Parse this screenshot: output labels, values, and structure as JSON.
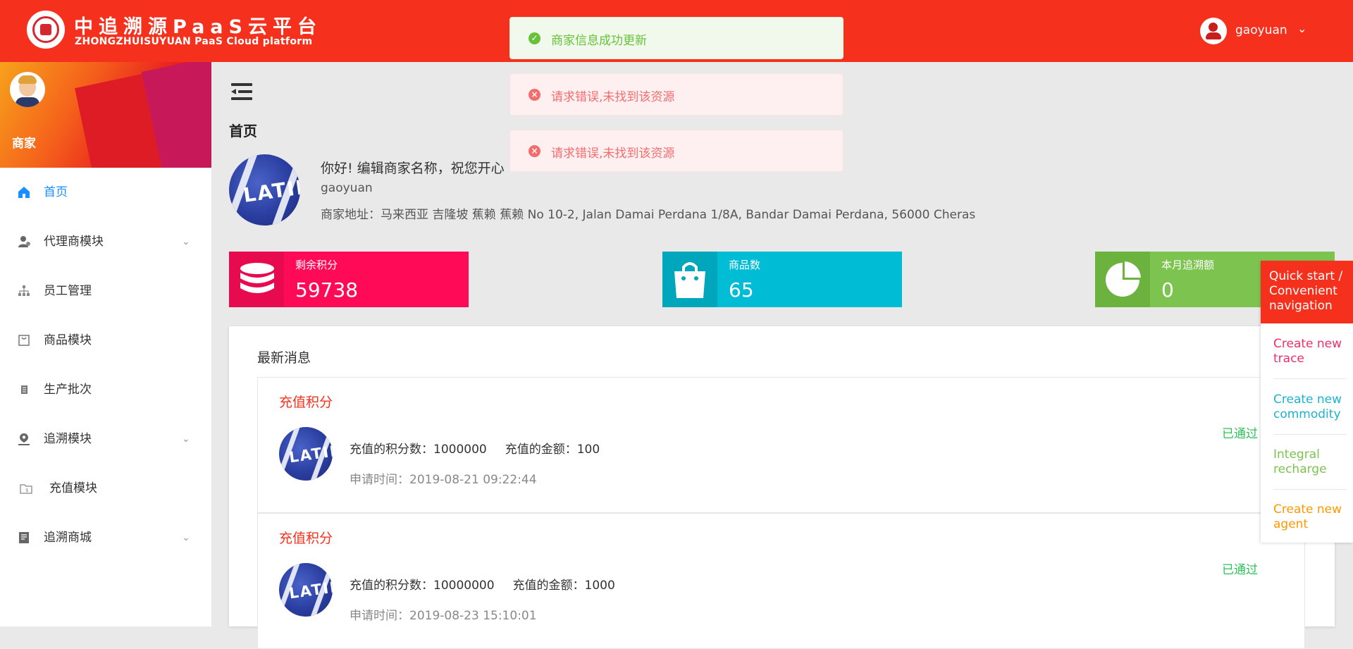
{
  "header": {
    "title": "中追溯源PaaS云平台",
    "subtitle": "ZHONGZHUISUYUAN PaaS Cloud platform",
    "user_name": "gaoyuan",
    "user_caret": "⌄"
  },
  "sidebar": {
    "role": "商家",
    "items": [
      {
        "label": "首页",
        "icon": "home-icon",
        "active": true,
        "has_caret": false
      },
      {
        "label": "代理商模块",
        "icon": "agent-user-icon",
        "has_caret": true
      },
      {
        "label": "员工管理",
        "icon": "org-tree-icon",
        "has_caret": false
      },
      {
        "label": "商品模块",
        "icon": "bag-icon",
        "has_caret": false
      },
      {
        "label": "生产批次",
        "icon": "list-icon",
        "has_caret": false
      },
      {
        "label": "追溯模块",
        "icon": "location-user-icon",
        "has_caret": true
      },
      {
        "label": "充值模块",
        "icon": "wallet-icon",
        "has_caret": false
      },
      {
        "label": "追溯商城",
        "icon": "store-icon",
        "has_caret": true
      }
    ],
    "caret": "⌄"
  },
  "main": {
    "page_title": "首页",
    "greeting": "你好! 编辑商家名称，祝您开心",
    "merchant_user": "gaoyuan",
    "merchant_addr": "商家地址：马来西亚 吉隆坡 蕉赖 蕉赖 No 10-2, Jalan Damai Perdana 1/8A, Bandar Damai Perdana, 56000 Cheras",
    "logo_text": "LATIN"
  },
  "stats": [
    {
      "label": "剩余积分",
      "value": "59738",
      "color": "#ff0a57",
      "icon_bg": "#e80a4f",
      "icon": "database-icon"
    },
    {
      "label": "商品数",
      "value": "65",
      "color": "#00bcd4",
      "icon_bg": "#00a6bc",
      "icon": "shopping-bag-icon"
    },
    {
      "label": "本月追溯额",
      "value": "0",
      "color": "#7cc44f",
      "icon_bg": "#6cb23f",
      "icon": "pie-chart-icon"
    }
  ],
  "messages": {
    "title": "最新消息",
    "items": [
      {
        "title": "充值积分",
        "points_label": "充值的积分数：1000000",
        "amount_label": "充值的金额：100",
        "time": "申请时间：2019-08-21 09:22:44",
        "status": "已通过"
      },
      {
        "title": "充值积分",
        "points_label": "充值的积分数：10000000",
        "amount_label": "充值的金额：1000",
        "time": "申请时间：2019-08-23 15:10:01",
        "status": "已通过"
      }
    ]
  },
  "toasts": [
    {
      "type": "success",
      "text": "商家信息成功更新",
      "icon": "✓"
    },
    {
      "type": "error",
      "text": "请求错误,未找到该资源",
      "icon": "×"
    },
    {
      "type": "error",
      "text": "请求错误,未找到该资源",
      "icon": "×"
    }
  ],
  "quick_nav": {
    "title": "Quick start / Convenient navigation",
    "items": [
      {
        "label": "Create new trace",
        "color": "#ee2f6c"
      },
      {
        "label": "Create new commodity",
        "color": "#1cb2d0"
      },
      {
        "label": "Integral recharge",
        "color": "#7cc44f"
      },
      {
        "label": "Create new agent",
        "color": "#ff9800"
      }
    ]
  },
  "colors": {
    "brand": "#f5301c",
    "active": "#1890ff",
    "approved": "#2ec15a"
  }
}
